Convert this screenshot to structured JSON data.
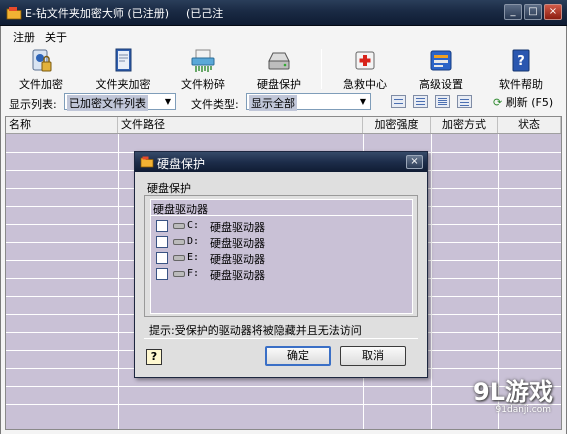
{
  "titlebar": {
    "title": "E-钻文件夹加密大师 (已注册)",
    "title_fragment": "(已己注",
    "minimize": "_",
    "maximize": "□",
    "close": "×"
  },
  "menu": [
    "注册",
    "关于"
  ],
  "toolbar": [
    {
      "label": "文件加密",
      "icon": "lock-key-icon"
    },
    {
      "label": "文件夹加密",
      "icon": "folder-document-icon"
    },
    {
      "label": "文件粉碎",
      "icon": "shredder-icon"
    },
    {
      "label": "硬盘保护",
      "icon": "hard-drive-icon"
    },
    {
      "label": "急救中心",
      "icon": "first-aid-icon"
    },
    {
      "label": "高级设置",
      "icon": "settings-icon"
    },
    {
      "label": "软件帮助",
      "icon": "help-book-icon"
    }
  ],
  "filter": {
    "display_list_label": "显示列表:",
    "display_list_value": "已加密文件列表",
    "file_type_label": "文件类型:",
    "file_type_value": "显示全部",
    "refresh_label": "刷新 (F5)"
  },
  "table": {
    "columns": [
      "名称",
      "文件路径",
      "加密强度",
      "加密方式",
      "状态"
    ],
    "rows": []
  },
  "dialog": {
    "title": "硬盘保护",
    "group_label": "硬盘保护",
    "list_header": "硬盘驱动器",
    "drives": [
      {
        "letter": "C:",
        "name": "硬盘驱动器",
        "checked": false
      },
      {
        "letter": "D:",
        "name": "硬盘驱动器",
        "checked": false
      },
      {
        "letter": "E:",
        "name": "硬盘驱动器",
        "checked": false
      },
      {
        "letter": "F:",
        "name": "硬盘驱动器",
        "checked": false
      }
    ],
    "hint": "提示:受保护的驱动器将被隐藏并且无法访问",
    "help": "?",
    "ok_label": "确定",
    "cancel_label": "取消",
    "close": "×"
  },
  "watermark": {
    "main": "9L游戏",
    "url": "91danji.com"
  },
  "colors": {
    "list_background": "#c9c1d6",
    "titlebar": "#1a2a44"
  }
}
